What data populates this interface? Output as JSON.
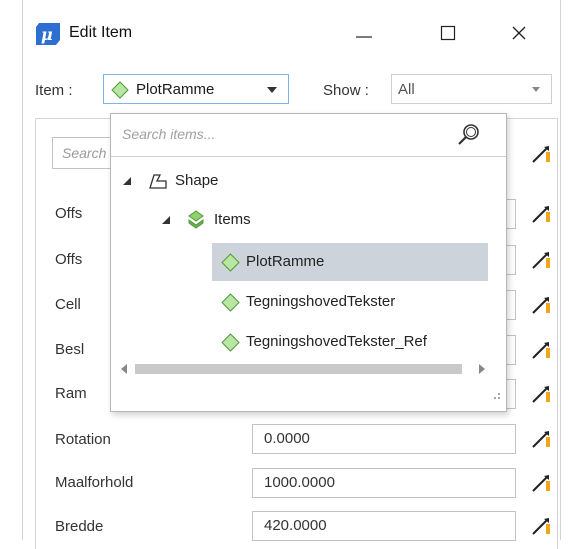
{
  "window": {
    "title": "Edit Item",
    "controls": {
      "minimize": "minimize-icon",
      "maximize": "maximize-icon",
      "close": "close-icon"
    }
  },
  "toolbar": {
    "item_label": "Item :",
    "item_value": "PlotRamme",
    "show_label": "Show :",
    "show_value": "All"
  },
  "search": {
    "placeholder": "Search"
  },
  "dropdown": {
    "placeholder": "Search items...",
    "tree": [
      {
        "label": "Shape",
        "icon": "shape-icon",
        "expanded": true
      },
      {
        "label": "Items",
        "icon": "items-icon",
        "expanded": true
      },
      {
        "label": "PlotRamme",
        "icon": "item-diamond-icon",
        "selected": true
      },
      {
        "label": "TegningshovedTekster",
        "icon": "item-diamond-icon"
      },
      {
        "label": "TegningshovedTekster_Ref",
        "icon": "item-diamond-icon"
      }
    ]
  },
  "properties": [
    {
      "label": "Offs",
      "value": ""
    },
    {
      "label": "Offs",
      "value": ""
    },
    {
      "label": "Cell",
      "value": ""
    },
    {
      "label": "Besl",
      "value": ""
    },
    {
      "label": "Ram",
      "value": ""
    },
    {
      "label": "Rotation",
      "value": "0.0000"
    },
    {
      "label": "Maalforhold",
      "value": "1000.0000"
    },
    {
      "label": "Bredde",
      "value": "420.0000"
    }
  ],
  "colors": {
    "accent_blue": "#2d6fd1",
    "item_green": "#8fd16a",
    "selection": "#cdd3da",
    "border": "#c3c3c3"
  }
}
